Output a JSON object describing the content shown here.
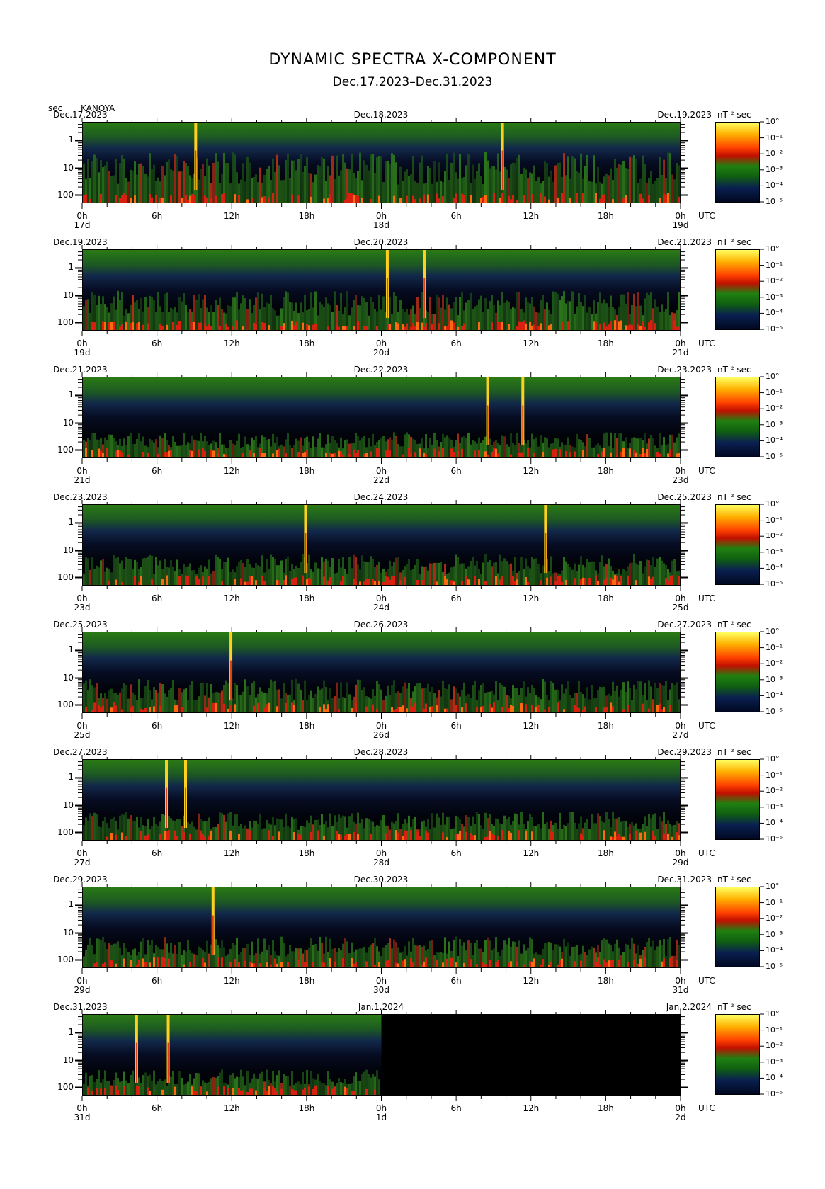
{
  "chart_data": {
    "type": "heatmap",
    "title": "DYNAMIC SPECTRA X-COMPONENT",
    "subtitle": "Dec.17.2023–Dec.31.2023",
    "station": "KANOYA",
    "y_unit": "sec",
    "colorbar_unit": "nT ² sec",
    "colorbar_ticks": [
      "10°",
      "10⁻¹",
      "10⁻²",
      "10⁻³",
      "10⁻⁴",
      "10⁻⁵"
    ],
    "y_ticks": [
      "1",
      "10",
      "100"
    ],
    "x_tick_labels": [
      "0h",
      "6h",
      "12h",
      "18h",
      "0h",
      "6h",
      "12h",
      "18h",
      "0h"
    ],
    "x_unit": "UTC",
    "panels": [
      {
        "date_left": "Dec.17.2023",
        "date_mid": "Dec.18.2023",
        "date_right": "Dec.19.2023",
        "day_left": "17d",
        "day_mid": "18d",
        "day_right": "19d",
        "spikes": [
          0.189,
          0.703
        ],
        "activity": 0.9,
        "nodata_from": null
      },
      {
        "date_left": "Dec.19.2023",
        "date_mid": "Dec.20.2023",
        "date_right": "Dec.21.2023",
        "day_left": "19d",
        "day_mid": "20d",
        "day_right": "21d",
        "spikes": [
          0.51,
          0.572
        ],
        "activity": 0.7,
        "nodata_from": null
      },
      {
        "date_left": "Dec.21.2023",
        "date_mid": "Dec.22.2023",
        "date_right": "Dec.23.2023",
        "day_left": "21d",
        "day_mid": "22d",
        "day_right": "23d",
        "spikes": [
          0.678,
          0.737
        ],
        "activity": 0.45,
        "nodata_from": null
      },
      {
        "date_left": "Dec.23.2023",
        "date_mid": "Dec.24.2023",
        "date_right": "Dec.25.2023",
        "day_left": "23d",
        "day_mid": "24d",
        "day_right": "25d",
        "spikes": [
          0.373,
          0.775
        ],
        "activity": 0.55,
        "nodata_from": null
      },
      {
        "date_left": "Dec.25.2023",
        "date_mid": "Dec.26.2023",
        "date_right": "Dec.27.2023",
        "day_left": "25d",
        "day_mid": "26d",
        "day_right": "27d",
        "spikes": [
          0.248
        ],
        "activity": 0.6,
        "nodata_from": null
      },
      {
        "date_left": "Dec.27.2023",
        "date_mid": "Dec.28.2023",
        "date_right": "Dec.29.2023",
        "day_left": "27d",
        "day_mid": "28d",
        "day_right": "29d",
        "spikes": [
          0.14,
          0.172
        ],
        "activity": 0.5,
        "nodata_from": null
      },
      {
        "date_left": "Dec.29.2023",
        "date_mid": "Dec.30.2023",
        "date_right": "Dec.31.2023",
        "day_left": "29d",
        "day_mid": "30d",
        "day_right": "31d",
        "spikes": [
          0.218
        ],
        "activity": 0.55,
        "nodata_from": null
      },
      {
        "date_left": "Dec.31.2023",
        "date_mid": "Jan.1.2024",
        "date_right": "Jan.2.2024",
        "day_left": "31d",
        "day_mid": "1d",
        "day_right": "2d",
        "spikes": [
          0.09,
          0.143
        ],
        "activity": 0.45,
        "nodata_from": 0.5
      }
    ]
  }
}
